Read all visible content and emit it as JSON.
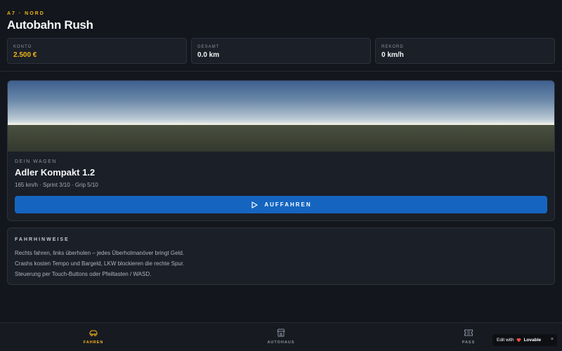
{
  "header": {
    "eyebrow": "A7 · NORD",
    "title": "Autobahn Rush",
    "stats": [
      {
        "label": "KONTO",
        "value": "2.500 €"
      },
      {
        "label": "GESAMT",
        "value": "0.0 km"
      },
      {
        "label": "REKORD",
        "value": "0 km/h"
      }
    ]
  },
  "car": {
    "label": "DEIN WAGEN",
    "name": "Adler Kompakt 1.2",
    "specs": "165 km/h · Sprint 3/10 · Grip 5/10",
    "drive_button": "AUFFAHREN",
    "drive_icon": "play-icon"
  },
  "hints": {
    "title": "FAHRHINWEISE",
    "lines": [
      "Rechts fahren, links überholen – jedes Überholmanöver bringt Geld.",
      "Crashs kosten Tempo und Bargeld, LKW blockieren die rechte Spur.",
      "Steuerung per Touch-Buttons oder Pfeiltasten / WASD."
    ]
  },
  "nav": {
    "items": [
      {
        "label": "FAHREN",
        "icon": "car-icon",
        "active": true
      },
      {
        "label": "AUTOHAUS",
        "icon": "store-icon",
        "active": false
      },
      {
        "label": "PASS",
        "icon": "ticket-icon",
        "active": false
      }
    ]
  },
  "badge": {
    "prefix": "Edit with",
    "brand": "Lovable",
    "close": "×"
  },
  "colors": {
    "accent": "#f2b417",
    "primary_button": "#1565c0",
    "background": "#13161c",
    "card": "#1b1f27"
  }
}
